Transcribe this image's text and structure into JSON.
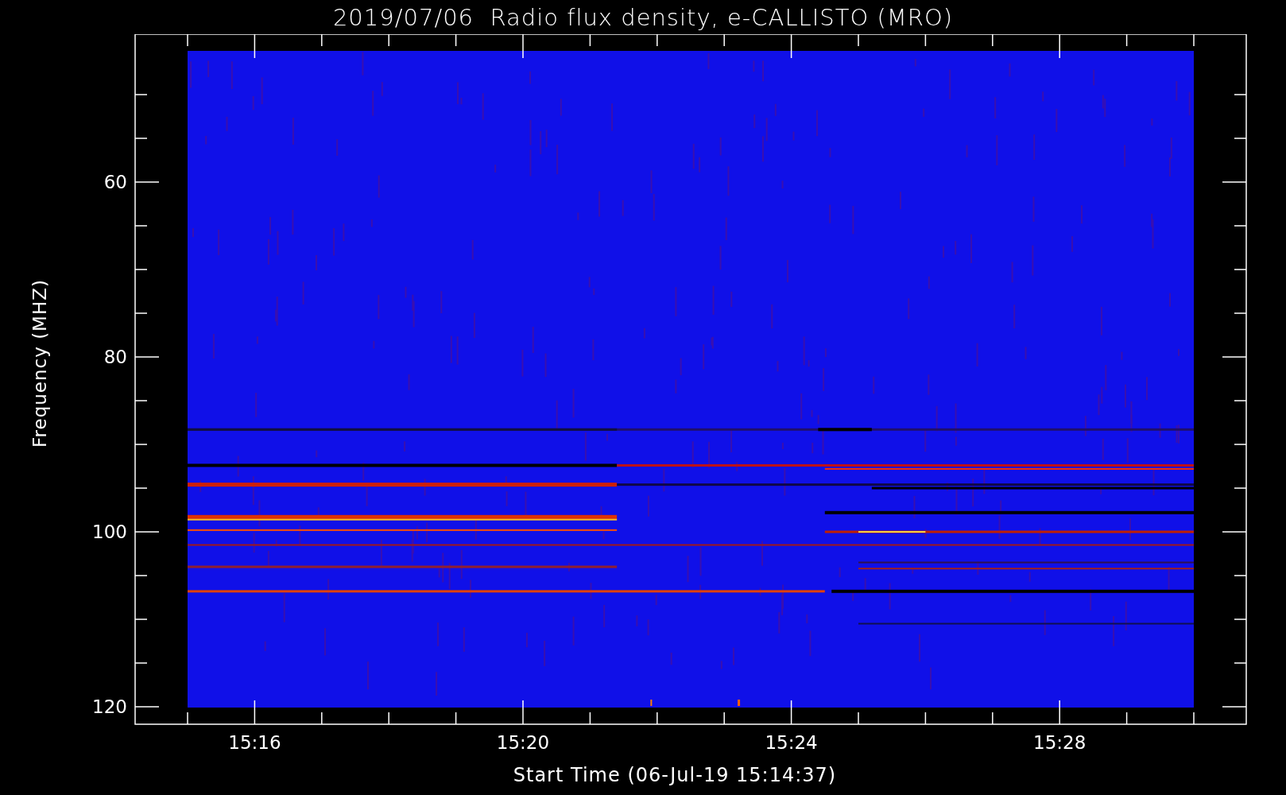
{
  "title": "2019/07/06  Radio flux density, e-CALLISTO (MRO)",
  "plot": {
    "y_axis": {
      "label": "Frequency (MHZ)",
      "ticks": [
        "60",
        "80",
        "100",
        "120"
      ]
    },
    "x_axis": {
      "label": "Start Time (06-Jul-19 15:14:37)",
      "ticks": [
        "15:16",
        "15:20",
        "15:24",
        "15:28"
      ]
    }
  }
}
